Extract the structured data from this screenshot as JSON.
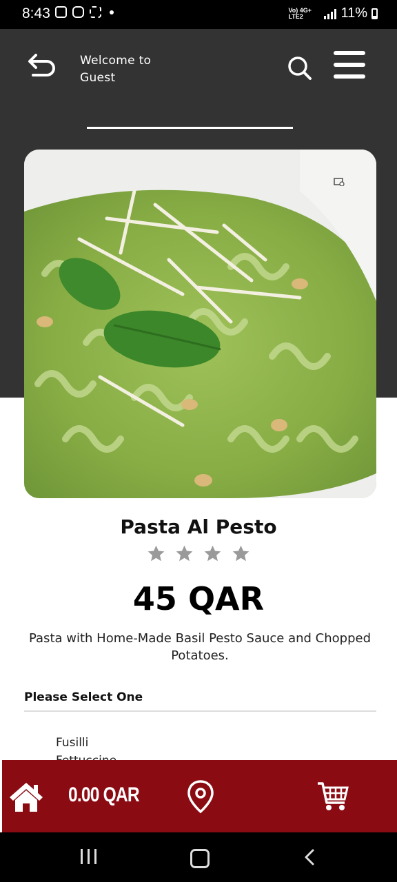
{
  "status_bar": {
    "time": "8:43",
    "network": "Vo) 4G+ LTE2",
    "battery": "11%"
  },
  "header": {
    "welcome_line1": "Welcome to",
    "welcome_line2": "Guest"
  },
  "product": {
    "name": "Pasta Al Pesto",
    "rating": {
      "filled": 0,
      "total": 4
    },
    "price": "45 QAR",
    "description": "Pasta with Home-Made Basil Pesto Sauce and Chopped Potatoes."
  },
  "options": {
    "title": "Please Select One",
    "items": [
      "Fusilli",
      "Fettuccine"
    ]
  },
  "bottom_bar": {
    "cart_total": "0.00 QAR"
  },
  "colors": {
    "header_bg": "#333333",
    "bottom_bar_bg": "#8b0b13",
    "star_color": "#9a9a9a"
  },
  "icons": {
    "back": "back-arrow-icon",
    "search": "search-icon",
    "menu": "hamburger-menu-icon",
    "home": "home-icon",
    "location": "location-pin-icon",
    "cart": "shopping-cart-icon"
  }
}
